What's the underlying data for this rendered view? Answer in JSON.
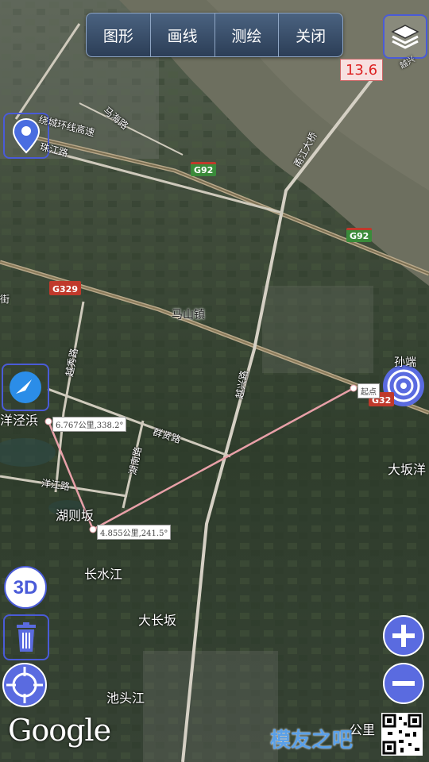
{
  "toolbar": {
    "shapes_label": "图形",
    "draw_line_label": "画线",
    "survey_label": "测绘",
    "close_label": "关闭"
  },
  "scale_value": "13.6",
  "roads": {
    "ring_expressway": "绕城环线高速",
    "mahai_road": "马海路",
    "zhujiang_road": "珠江路",
    "yongjiang_bridge": "甬江大桥",
    "yuexiu_road": "越秀路",
    "yuexing_road": "越兴路",
    "qunxian_road": "群贤路",
    "hunan_road": "湖南路",
    "yangjiang_road": "洋江路",
    "jie": "街",
    "yue_fragment": "越兴",
    "g92_a": "G92",
    "g92_b": "G92",
    "g329": "G329",
    "g32_fragment": "G32"
  },
  "places": {
    "mashan_town": "马山镇",
    "yangjingbang": "洋泾浜",
    "huzeban": "湖则坂",
    "changshuijiang": "长水江",
    "dachangban": "大长坂",
    "chitoujiang": "池头江",
    "daban_yang": "大坂洋",
    "sunduan": "孙端"
  },
  "measure": {
    "start_label": "起点",
    "segment1_label": "4.855公里,241.5°",
    "segment2_label": "6.767公里,338.2°"
  },
  "branding": {
    "google": "Google",
    "watermark": "模友之吧",
    "km_fragment": "公里"
  },
  "icons": {
    "layers": "layers-icon",
    "locate_pin": "location-pin-icon",
    "compass": "compass-icon",
    "target": "target-icon",
    "three_d": "3d-icon",
    "trash": "trash-icon",
    "gps": "gps-crosshair-icon",
    "zoom_in": "zoom-in-icon",
    "zoom_out": "zoom-out-icon"
  },
  "colors": {
    "control_blue": "#4a5bd8",
    "measure_line": "#e8a0a8"
  }
}
